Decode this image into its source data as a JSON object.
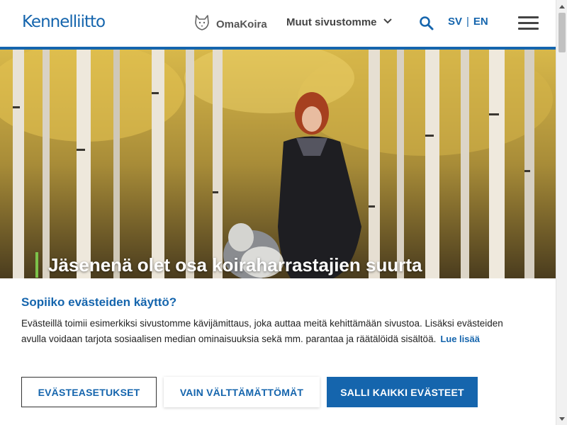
{
  "header": {
    "logo": "Kennelliitto",
    "omakoira_label": "OmaKoira",
    "muut_label": "Muut sivustomme",
    "lang_sv": "SV",
    "lang_sep": "|",
    "lang_en": "EN"
  },
  "hero": {
    "title": "Jäsenenä olet osa koiraharrastajien suurta"
  },
  "cookie": {
    "title": "Sopiiko evästeiden käyttö?",
    "text": "Evästeillä toimii esimerkiksi sivustomme kävijämittaus, joka auttaa meitä kehittämään sivustoa. Lisäksi evästeiden avulla voidaan tarjota sosiaalisen median ominaisuuksia sekä mm. parantaa ja räätälöidä sisältöä.",
    "read_more": "Lue lisää",
    "btn_settings": "EVÄSTEASETUKSET",
    "btn_necessary": "VAIN VÄLTTÄMÄTTÖMÄT",
    "btn_all": "SALLI KAIKKI EVÄSTEET"
  },
  "colors": {
    "brand_blue": "#1565ad",
    "accent_green": "#7cc24a"
  },
  "icons": {
    "omakoira": "dog-head-icon",
    "muut": "chevron-down-icon",
    "search": "search-icon",
    "menu": "hamburger-menu-icon",
    "scroll_up": "arrow-up-icon",
    "scroll_down": "arrow-down-icon"
  }
}
